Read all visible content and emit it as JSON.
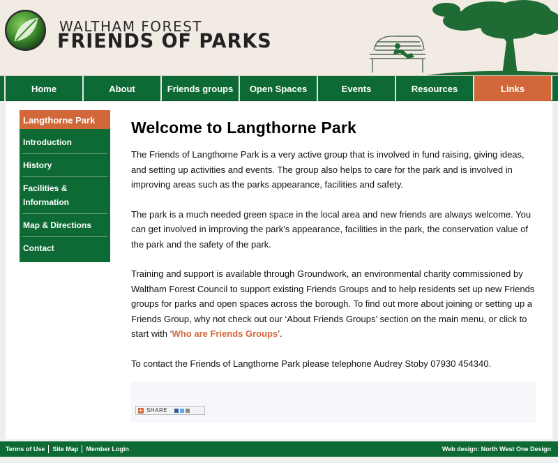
{
  "header": {
    "site_title_small": "WALTHAM FOREST",
    "site_title_big": "FRIENDS OF PARKS",
    "logo_icon": "leaf-icon"
  },
  "nav": {
    "items": [
      {
        "label": "Home"
      },
      {
        "label": "About"
      },
      {
        "label": "Friends groups"
      },
      {
        "label": "Open Spaces"
      },
      {
        "label": "Events"
      },
      {
        "label": "Resources"
      },
      {
        "label": "Links",
        "active": true
      }
    ]
  },
  "sidebar": {
    "heading": "Langthorne Park",
    "items": [
      {
        "label": "Introduction"
      },
      {
        "label": "History"
      },
      {
        "label": "Facilities & Information"
      },
      {
        "label": "Map & Directions"
      },
      {
        "label": "Contact"
      }
    ]
  },
  "main": {
    "title": "Welcome to Langthorne Park",
    "para1": "The Friends of Langthorne Park is a very active group that is involved in fund raising, giving ideas, and setting up activities and events. The group also helps to care for the park and is involved in improving areas such as the parks appearance, facilities and safety.",
    "para2": "The park is a much needed green space in the local area and new friends are always welcome. You can get involved in improving the park's appearance, facilities in the park, the conservation value of the park and the safety of the park.",
    "para3_text": "Training and support is available through Groundwork, an environmental charity commissioned by Waltham Forest Council to support existing Friends Groups and to help residents set up new Friends groups for parks and open spaces across the borough. To find out more about joining or setting up a Friends Group, why not check out our ‘About Friends Groups’ section on the main menu, or click to start with ‘",
    "para3_link": "Who are Friends Groups",
    "para3_end": "’.",
    "para4": "To contact the Friends of Langthorne Park please telephone Audrey Stoby 07930 454340.",
    "share_label": "SHARE"
  },
  "footer": {
    "links": [
      "Terms of Use",
      "Site Map",
      "Member Login"
    ],
    "credit": "Web design: North West One Design"
  },
  "colors": {
    "green": "#0e6a35",
    "orange": "#d2683a",
    "header_bg": "#f1ebe3"
  }
}
